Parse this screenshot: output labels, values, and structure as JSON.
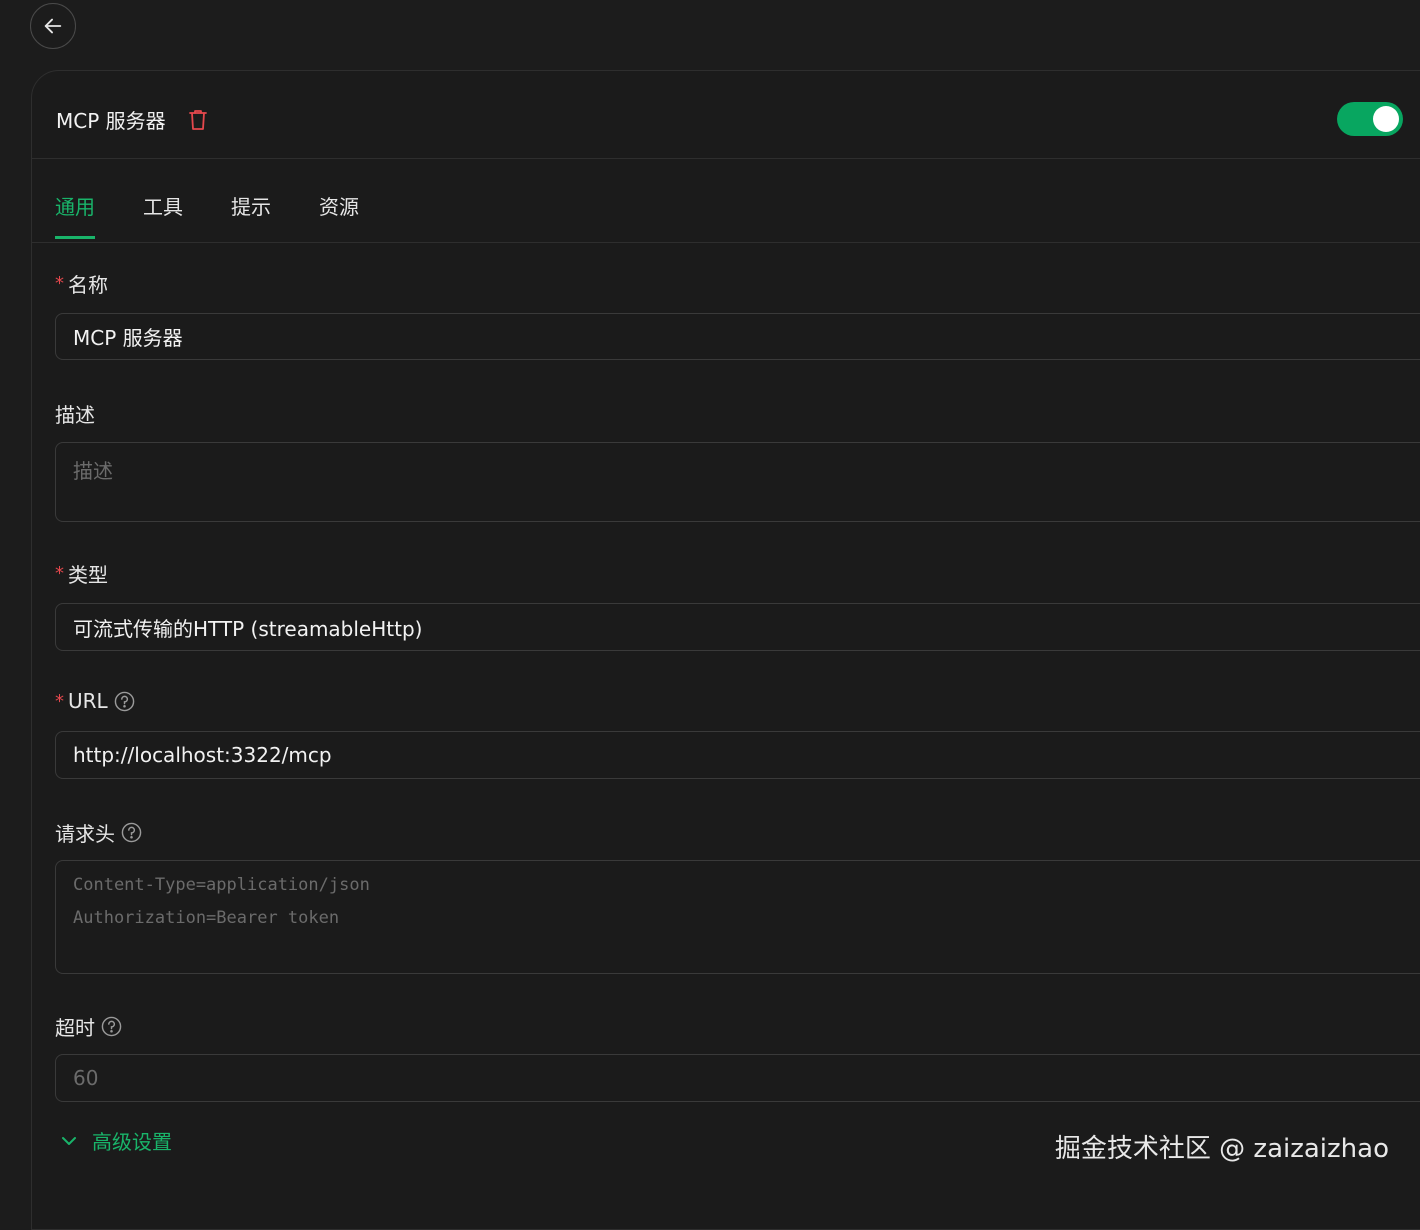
{
  "header": {
    "title": "MCP 服务器",
    "enabled": true
  },
  "tabs": [
    "通用",
    "工具",
    "提示",
    "资源"
  ],
  "active_tab": "通用",
  "fields": {
    "name": {
      "label": "名称",
      "required": true,
      "value": "MCP 服务器"
    },
    "description": {
      "label": "描述",
      "required": false,
      "value": "",
      "placeholder": "描述"
    },
    "type": {
      "label": "类型",
      "required": true,
      "value": "可流式传输的HTTP (streamableHttp)"
    },
    "url": {
      "label": "URL",
      "required": true,
      "value": "http://localhost:3322/mcp"
    },
    "headers": {
      "label": "请求头",
      "required": false,
      "value": "",
      "placeholder_lines": [
        "Content-Type=application/json",
        "Authorization=Bearer token"
      ]
    },
    "timeout": {
      "label": "超时",
      "required": false,
      "value": "",
      "placeholder": "60"
    }
  },
  "advanced": {
    "label": "高级设置"
  },
  "watermark": "掘金技术社区 @ zaizaizhao",
  "colors": {
    "accent": "#19b46a",
    "toggle_on": "#08a660",
    "required": "#e5484d",
    "danger": "#e5484d"
  },
  "icons": [
    "arrow-left-icon",
    "trash-icon",
    "help-circle-icon",
    "chevron-down-icon"
  ]
}
